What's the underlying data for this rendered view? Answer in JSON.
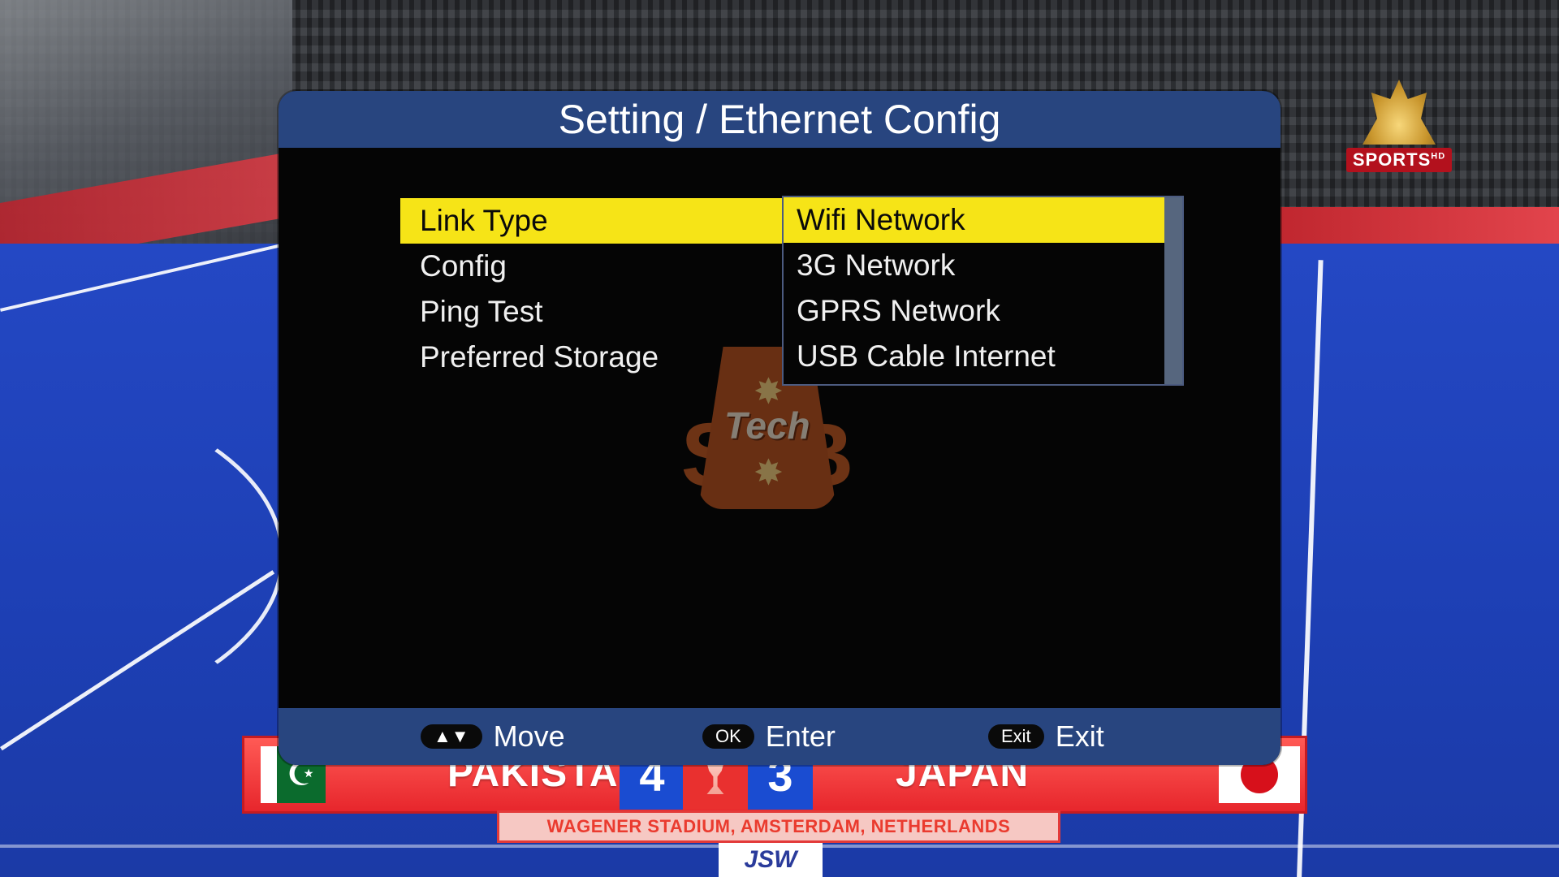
{
  "menu": {
    "title": "Setting / Ethernet Config",
    "items": [
      {
        "label": "Link Type"
      },
      {
        "label": "Config"
      },
      {
        "label": "Ping Test"
      },
      {
        "label": "Preferred Storage"
      }
    ],
    "dropdown": {
      "options": [
        "Wifi Network",
        "3G Network",
        "GPRS Network",
        "USB Cable Internet"
      ],
      "selected": "Wifi Network"
    },
    "hints": [
      {
        "key": "▲▼",
        "label": "Move"
      },
      {
        "key": "OK",
        "label": "Enter"
      },
      {
        "key": "Exit",
        "label": "Exit"
      }
    ]
  },
  "broadcast": {
    "channel_logo": "SPORTS",
    "channel_logo_suffix": "HD",
    "team_left": "PAKISTAN",
    "score_left": "4",
    "score_right": "3",
    "team_right": "JAPAN",
    "venue": "WAGENER STADIUM, AMSTERDAM, NETHERLANDS",
    "sponsor": "JSW"
  },
  "watermark": {
    "word": "Tech",
    "letters": "SB"
  },
  "colors": {
    "header_bar": "#28457f",
    "highlight": "#f6e417",
    "menu_bg": "#050505",
    "pitch": "#1f3fae",
    "scoreboard": "#e7262c"
  }
}
